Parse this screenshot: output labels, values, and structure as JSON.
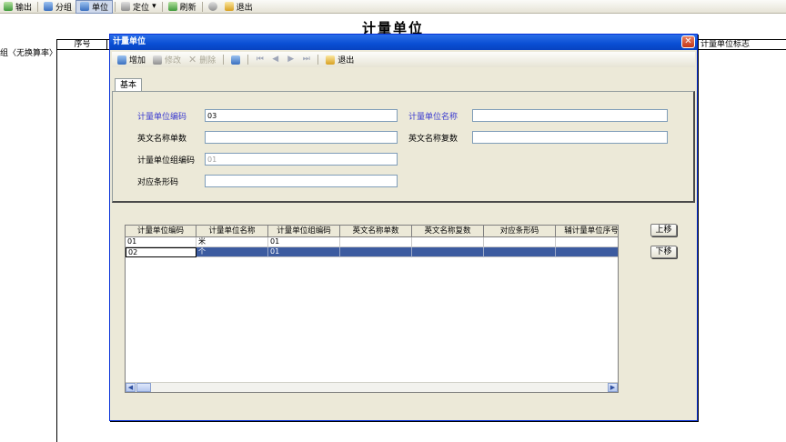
{
  "bg_toolbar": {
    "items": [
      {
        "label": "输出",
        "icon": "export-icon"
      },
      {
        "label": "分组",
        "icon": "group-icon"
      },
      {
        "label": "单位",
        "icon": "unit-icon"
      },
      {
        "label": "定位",
        "icon": "locate-icon"
      },
      {
        "label": "刷新",
        "icon": "refresh-icon"
      },
      {
        "label": "退出",
        "icon": "exit-icon"
      }
    ]
  },
  "bg": {
    "title": "计量单位",
    "tree_item": "组〈无换算率〉",
    "col_seq": "序号",
    "col_flag": "计量单位标志"
  },
  "dialog": {
    "title": "计量单位",
    "close_glyph": "✕",
    "toolbar": {
      "add": "增加",
      "edit": "修改",
      "delete": "删除",
      "exit": "退出"
    },
    "tab": "基本",
    "form": {
      "unit_code_label": "计量单位编码",
      "unit_code_value": "03",
      "unit_name_label": "计量单位名称",
      "unit_name_value": "",
      "en_single_label": "英文名称单数",
      "en_single_value": "",
      "en_plural_label": "英文名称复数",
      "en_plural_value": "",
      "group_code_label": "计量单位组编码",
      "group_code_value": "01",
      "barcode_label": "对应条形码",
      "barcode_value": ""
    },
    "grid": {
      "columns": [
        "计量单位编码",
        "计量单位名称",
        "计量单位组编码",
        "英文名称单数",
        "英文名称复数",
        "对应条形码",
        "辅计量单位序号"
      ],
      "rows": [
        [
          "01",
          "米",
          "01",
          "",
          "",
          "",
          ""
        ],
        [
          "02",
          "个",
          "01",
          "",
          "",
          "",
          ""
        ]
      ]
    },
    "move_up": "上移",
    "move_down": "下移"
  },
  "colors": {
    "title_bar": "#0a4fd4",
    "dialog_bg": "#ece9d8",
    "selected_row": "#3c5ba0",
    "required_label": "#3a3ad0"
  }
}
